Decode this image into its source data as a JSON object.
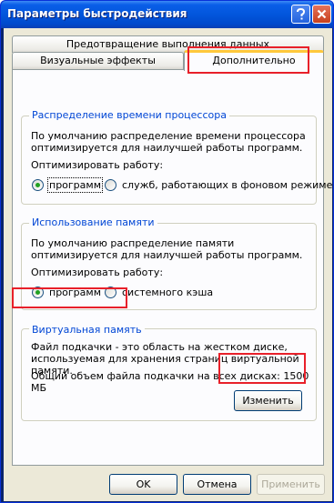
{
  "window": {
    "title": "Параметры быстродействия"
  },
  "tabs": {
    "back": "Предотвращение выполнения данных",
    "visual": "Визуальные эффекты",
    "active": "Дополнительно"
  },
  "cpu": {
    "title": "Распределение времени процессора",
    "description": "По умолчанию распределение времени процессора оптимизируется для наилучшей работы программ.",
    "optimize_label": "Оптимизировать работу:",
    "options": [
      "программ",
      "служб, работающих в фоновом режиме"
    ]
  },
  "memory": {
    "title": "Использование памяти",
    "description": "По умолчанию распределение памяти оптимизируется для наилучшей работы программ.",
    "optimize_label": "Оптимизировать работу:",
    "options": [
      "программ",
      "системного кэша"
    ]
  },
  "virtual": {
    "title": "Виртуальная память",
    "description": "Файл подкачки - это область на жестком диске, используемая для хранения страниц виртуальной памяти.",
    "total_label": "Общий объем файла подкачки на всех дисках:",
    "total_value": "1500 МБ",
    "change_button": "Изменить"
  },
  "footer": {
    "ok": "OK",
    "cancel": "Отмена",
    "apply": "Применить"
  },
  "colors": {
    "highlight": "#e8202a",
    "group_title": "#0046d5",
    "titlebar": "#0256dc"
  },
  "icons": [
    "help-icon",
    "close-icon"
  ]
}
